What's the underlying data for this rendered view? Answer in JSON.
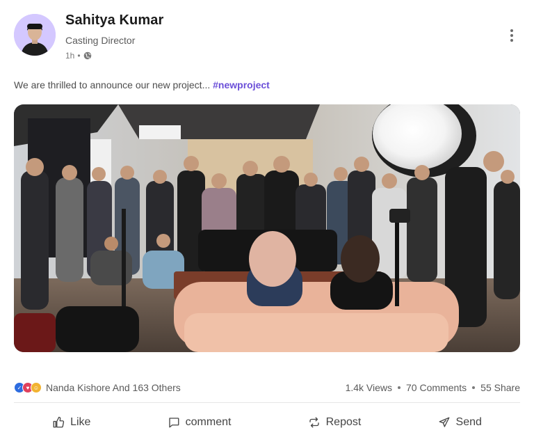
{
  "post": {
    "author": {
      "name": "Sahitya Kumar",
      "role": "Casting Director",
      "time": "1h",
      "visibility_icon": "globe-icon"
    },
    "menu_icon": "more-vertical-icon",
    "text": "We are thrilled to announce our new project...",
    "hashtag": "#newproject",
    "photo_icon": "studio-crowd-photo",
    "reactions": {
      "icons": [
        "like-icon",
        "love-icon",
        "wow-icon"
      ],
      "colors": [
        "#2d6cdf",
        "#e0415d",
        "#f2b331"
      ],
      "summary": "Nanda Kishore And 163 Others"
    },
    "stats": {
      "views": "1.4k Views",
      "comments": "70 Comments",
      "shares": "55 Share"
    },
    "actions": [
      {
        "label": "Like",
        "icon": "thumbs-up-icon"
      },
      {
        "label": "comment",
        "icon": "comment-icon"
      },
      {
        "label": "Repost",
        "icon": "repost-icon"
      },
      {
        "label": "Send",
        "icon": "send-icon"
      }
    ],
    "colors": {
      "hashtag": "#6b4fd8",
      "avatar_bg": "#d2c6ff"
    }
  }
}
